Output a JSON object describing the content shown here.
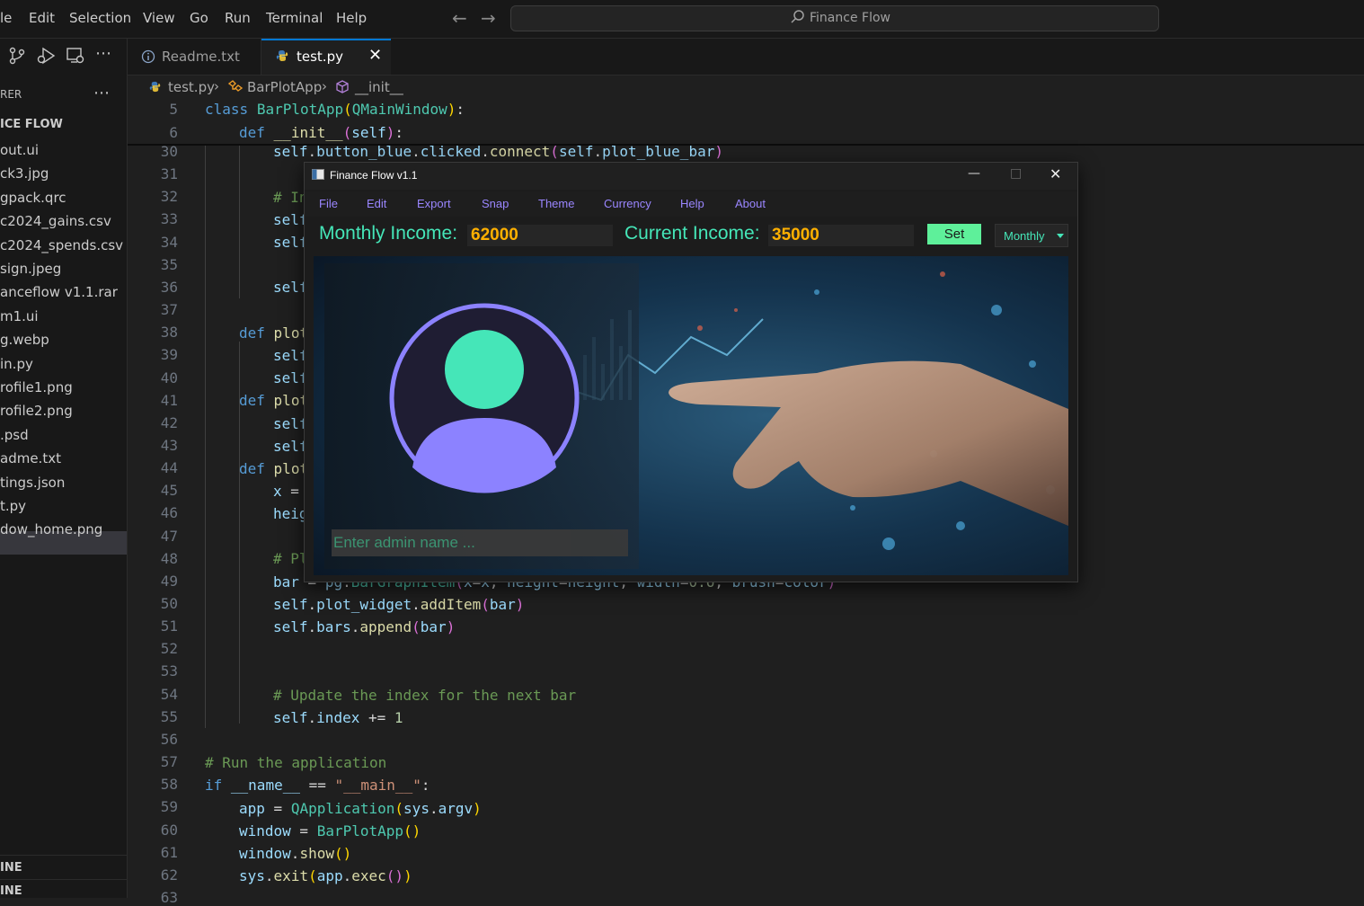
{
  "menubar": {
    "items": [
      "le",
      "Edit",
      "Selection",
      "View",
      "Go",
      "Run",
      "Terminal",
      "Help"
    ],
    "search_text": "Finance Flow"
  },
  "sidebar": {
    "header": "RER",
    "section": "ICE FLOW",
    "files": [
      "out.ui",
      "ck3.jpg",
      "gpack.qrc",
      "c2024_gains.csv",
      "c2024_spends.csv",
      "sign.jpeg",
      "anceflow v1.1.rar",
      "m1.ui",
      "g.webp",
      "in.py",
      "rofile1.png",
      "rofile2.png",
      ".psd",
      "adme.txt",
      "tings.json",
      "t.py",
      "dow_home.png"
    ],
    "selected_index": 15,
    "bottom_1": "INE",
    "bottom_2": "INE"
  },
  "tabs": [
    {
      "label": "Readme.txt"
    },
    {
      "label": "test.py"
    }
  ],
  "breadcrumb": {
    "file": "test.py",
    "class": "BarPlotApp",
    "method": "__init__"
  },
  "editor": {
    "sticky_lines": [
      "5",
      "6"
    ],
    "line_numbers": [
      "30",
      "31",
      "32",
      "33",
      "34",
      "35",
      "36",
      "37",
      "38",
      "39",
      "40",
      "41",
      "42",
      "43",
      "44",
      "45",
      "46",
      "47",
      "48",
      "49",
      "50",
      "51",
      "52",
      "53",
      "54",
      "55",
      "56",
      "57",
      "58",
      "59",
      "60",
      "61",
      "62",
      "63"
    ]
  },
  "app": {
    "title": "Finance Flow v1.1",
    "menu": [
      "File",
      "Edit",
      "Export",
      "Snap",
      "Theme",
      "Currency",
      "Help",
      "About"
    ],
    "monthly_income_label": "Monthly Income:",
    "monthly_income_value": "62000",
    "current_income_label": "Current Income:",
    "current_income_value": "35000",
    "set_button": "Set",
    "period_select": "Monthly",
    "admin_placeholder": "Enter admin name ...",
    "colors": {
      "accent_teal": "#45e6b8",
      "accent_purple": "#8c82ff",
      "value_orange": "#ffb000",
      "set_green": "#5ef09a"
    }
  }
}
